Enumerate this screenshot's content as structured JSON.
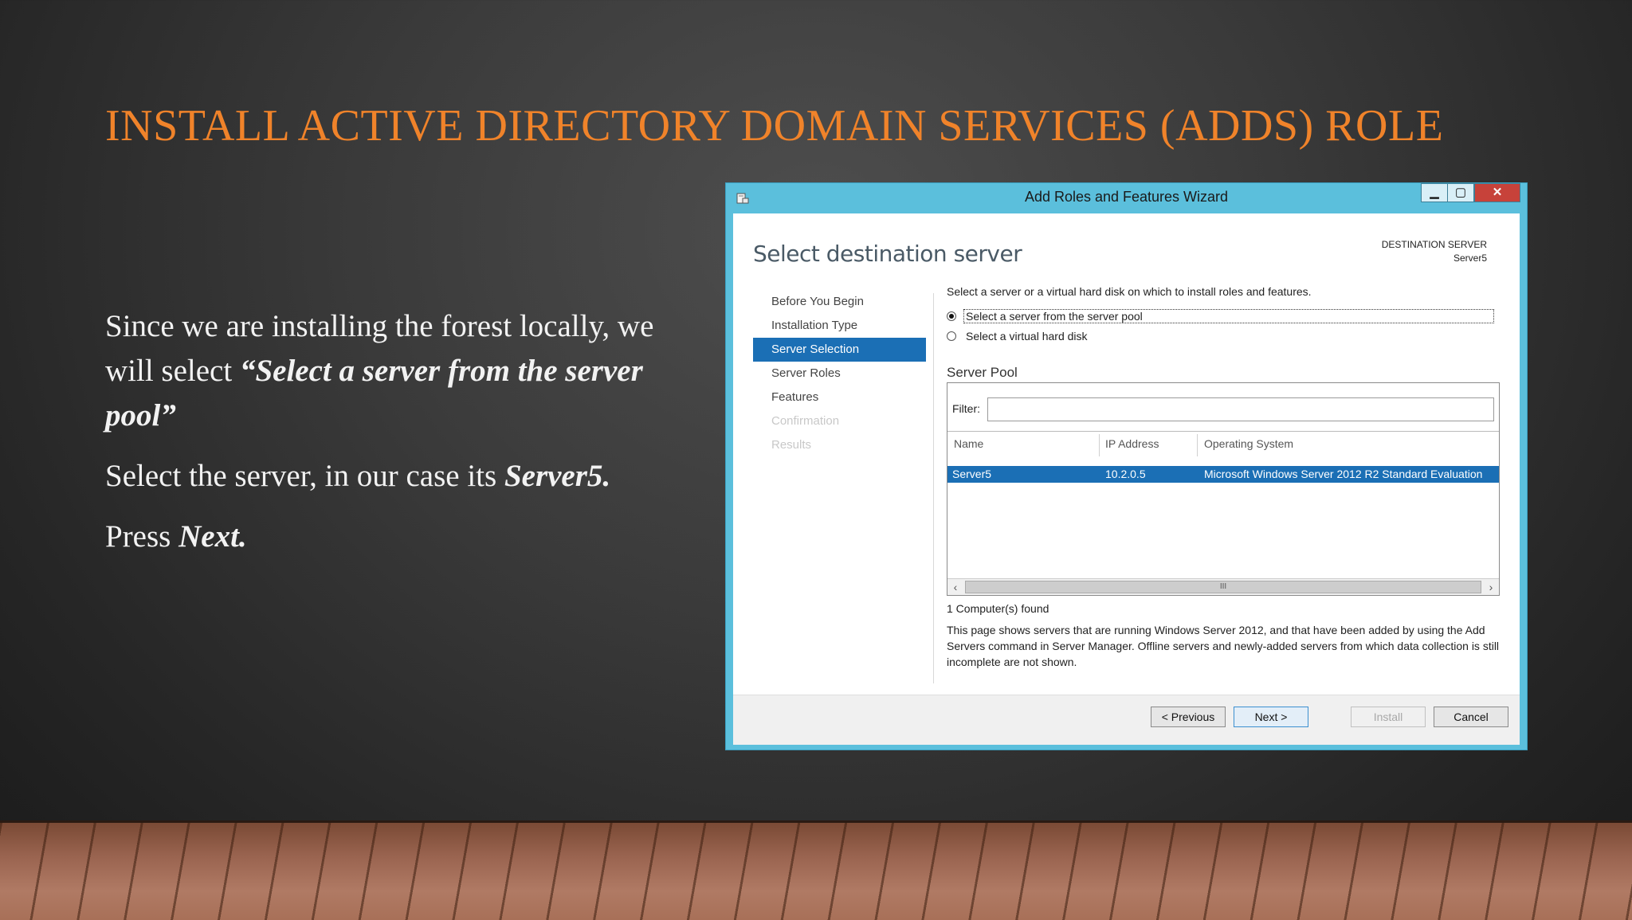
{
  "slide": {
    "title": "INSTALL ACTIVE DIRECTORY DOMAIN SERVICES (ADDS) ROLE",
    "para1_start": "Since we are installing the forest locally, we will select ",
    "para1_em": "“Select a server from the server pool”",
    "para2_start": "Select the server, in our case its ",
    "para2_em": "Server5.",
    "para3_start": "Press ",
    "para3_em": "Next."
  },
  "window": {
    "title": "Add Roles and Features Wizard",
    "min_glyph": "▁",
    "max_glyph": "▢",
    "close_glyph": "✕",
    "page_heading": "Select destination server",
    "destination_label": "DESTINATION SERVER",
    "destination_server": "Server5"
  },
  "nav": {
    "items": [
      {
        "label": "Before You Begin",
        "state": "normal"
      },
      {
        "label": "Installation Type",
        "state": "normal"
      },
      {
        "label": "Server Selection",
        "state": "active"
      },
      {
        "label": "Server Roles",
        "state": "normal"
      },
      {
        "label": "Features",
        "state": "normal"
      },
      {
        "label": "Confirmation",
        "state": "disabled"
      },
      {
        "label": "Results",
        "state": "disabled"
      }
    ]
  },
  "content": {
    "instruction": "Select a server or a virtual hard disk on which to install roles and features.",
    "radio_pool": "Select a server from the server pool",
    "radio_vhd": "Select a virtual hard disk",
    "pool_title": "Server Pool",
    "filter_label": "Filter:",
    "filter_value": "",
    "columns": [
      "Name",
      "IP Address",
      "Operating System"
    ],
    "rows": [
      {
        "name": "Server5",
        "ip": "10.2.0.5",
        "os": "Microsoft Windows Server 2012 R2 Standard Evaluation"
      }
    ],
    "scroll_left": "‹",
    "scroll_thumb": "III",
    "scroll_right": "›",
    "found": "1 Computer(s) found",
    "description": "This page shows servers that are running Windows Server 2012, and that have been added by using the Add Servers command in Server Manager. Offline servers and newly-added servers from which data collection is still incomplete are not shown."
  },
  "footer": {
    "previous": "< Previous",
    "next": "Next >",
    "install": "Install",
    "cancel": "Cancel"
  }
}
